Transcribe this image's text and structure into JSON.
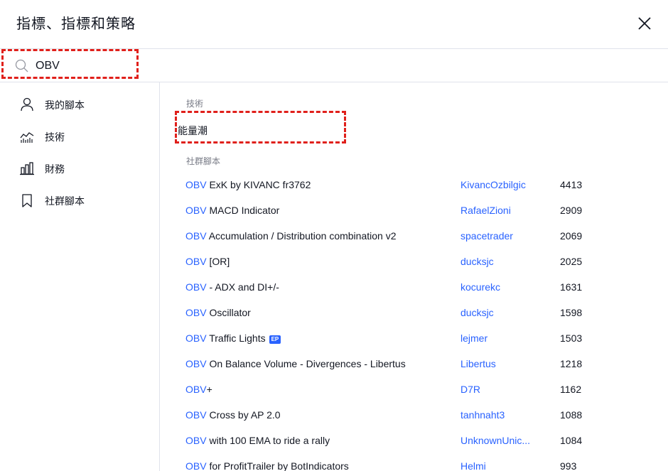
{
  "dialog": {
    "title": "指標、指標和策略"
  },
  "search": {
    "value": "OBV"
  },
  "sidebar": {
    "items": [
      {
        "label": "我的腳本",
        "icon": "user-icon"
      },
      {
        "label": "技術",
        "icon": "chart-icon"
      },
      {
        "label": "財務",
        "icon": "bar-chart-icon"
      },
      {
        "label": "社群腳本",
        "icon": "bookmark-icon"
      }
    ]
  },
  "sections": {
    "technical": "技術",
    "community": "社群腳本"
  },
  "technical_items": [
    {
      "label": "能量潮"
    }
  ],
  "community_scripts": [
    {
      "keyword": "OBV",
      "rest": " ExK by KIVANC fr3762",
      "author": "KivancOzbilgic",
      "count": "4413"
    },
    {
      "keyword": "OBV",
      "rest": " MACD Indicator",
      "author": "RafaelZioni",
      "count": "2909"
    },
    {
      "keyword": "OBV",
      "rest": " Accumulation / Distribution combination v2",
      "author": "spacetrader",
      "count": "2069"
    },
    {
      "keyword": "OBV",
      "rest": " [OR]",
      "author": "ducksjc",
      "count": "2025"
    },
    {
      "keyword": "OBV",
      "rest": " - ADX and DI+/-",
      "author": "kocurekc",
      "count": "1631"
    },
    {
      "keyword": "OBV",
      "rest": " Oscillator",
      "author": "ducksjc",
      "count": "1598"
    },
    {
      "keyword": "OBV",
      "rest": " Traffic Lights",
      "badge": "EP",
      "author": "lejmer",
      "count": "1503"
    },
    {
      "keyword": "OBV",
      "rest": " On Balance Volume - Divergences - Libertus",
      "author": "Libertus",
      "count": "1218"
    },
    {
      "keyword": "OBV",
      "rest": "+",
      "author": "D7R",
      "count": "1162"
    },
    {
      "keyword": "OBV",
      "rest": " Cross by AP 2.0",
      "author": "tanhnaht3",
      "count": "1088"
    },
    {
      "keyword": "OBV",
      "rest": " with 100 EMA to ride a rally",
      "author": "UnknownUnic...",
      "count": "1084"
    },
    {
      "keyword": "OBV",
      "rest": " for ProfitTrailer by BotIndicators",
      "author": "Helmi",
      "count": "993"
    }
  ],
  "colors": {
    "accent": "#2962ff",
    "highlight": "#e0201b",
    "border": "#e0e3eb",
    "muted": "#787b86"
  }
}
